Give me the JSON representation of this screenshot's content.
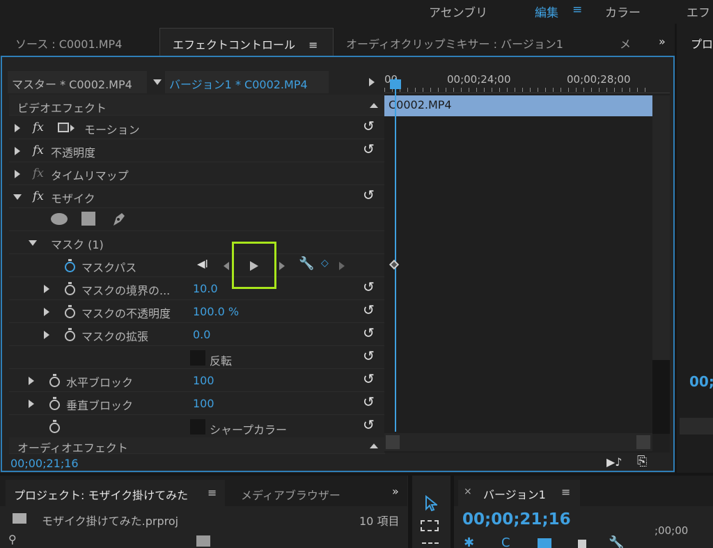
{
  "workspace_tabs": [
    "アセンブリ",
    "編集",
    "カラー",
    "エフ"
  ],
  "panel_tabs": {
    "source": "ソース : C0001.MP4",
    "effect_controls": "エフェクトコントロール",
    "audio_mixer": "オーディオクリップミキサー : バージョン1",
    "more": "メ",
    "right": "プロ"
  },
  "header": {
    "master": "マスター * C0002.MP4",
    "sequence_clip": "バージョン1 * C0002.MP4"
  },
  "sections": {
    "video_effects": "ビデオエフェクト",
    "audio_effects": "オーディオエフェクト"
  },
  "effects": {
    "motion": "モーション",
    "opacity": "不透明度",
    "time_remap": "タイムリマップ",
    "mosaic": "モザイク",
    "mask": "マスク (1)",
    "mask_path": "マスクパス",
    "mask_feather": "マスクの境界の...",
    "mask_feather_value": "10.0",
    "mask_opacity": "マスクの不透明度",
    "mask_opacity_value": "100.0 %",
    "mask_expansion": "マスクの拡張",
    "mask_expansion_value": "0.0",
    "invert": "反転",
    "horizontal_blocks": "水平ブロック",
    "horizontal_blocks_value": "100",
    "vertical_blocks": "垂直ブロック",
    "vertical_blocks_value": "100",
    "sharp_colors": "シャープカラー"
  },
  "timeline": {
    "start": "00",
    "tick1": "00;00;24;00",
    "tick2": "00;00;28;00",
    "clip": "C0002.MP4"
  },
  "timecode": "00;00;21;16",
  "project": {
    "title": "プロジェクト: モザイク掛けてみた",
    "media_browser": "メディアブラウザー",
    "file": "モザイク掛けてみた.prproj",
    "count": "10 項目"
  },
  "sequence": {
    "name": "バージョン1",
    "timecode": "00;00;21;16",
    "ruler": ";00;00"
  },
  "right_timecode": "00;",
  "colors": {
    "accent": "#3fa0e0",
    "highlight": "#a8e61c",
    "clip": "#7fa6d4"
  }
}
